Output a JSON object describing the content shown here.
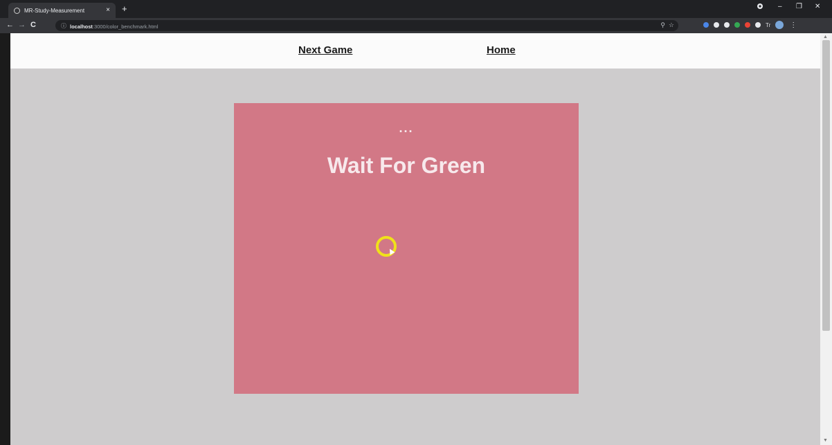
{
  "browser": {
    "tab_title": "MR-Study-Measurement",
    "tab_close": "×",
    "new_tab": "+",
    "window_controls": {
      "minimize": "–",
      "restore": "❐",
      "close": "✕"
    },
    "nav": {
      "back": "←",
      "forward": "→",
      "reload": "C"
    },
    "omnibox": {
      "info_icon": "ⓘ",
      "host": "localhost",
      "path": ":3000/color_benchmark.html"
    },
    "omnibox_actions": {
      "zoom_icon": "⚲",
      "star_icon": "☆"
    },
    "extensions": [
      {
        "name": "extension-1",
        "color": "#4a86e8"
      },
      {
        "name": "extension-2",
        "color": "#e8eaed"
      },
      {
        "name": "extension-3",
        "color": "#e8eaed"
      },
      {
        "name": "extension-4",
        "color": "#34a853"
      },
      {
        "name": "extension-5",
        "color": "#ea4335"
      },
      {
        "name": "extension-6",
        "color": "#e8eaed"
      }
    ],
    "ext_text": "Tr",
    "menu_icon": "⋮"
  },
  "page": {
    "nav": {
      "next_game": "Next Game",
      "home": "Home"
    },
    "game": {
      "indicator": "...",
      "title": "Wait For Green",
      "background_color": "#d27886"
    }
  },
  "colors": {
    "viewport_bg": "#cecccd",
    "cursor_highlight": "#f0e11a"
  }
}
